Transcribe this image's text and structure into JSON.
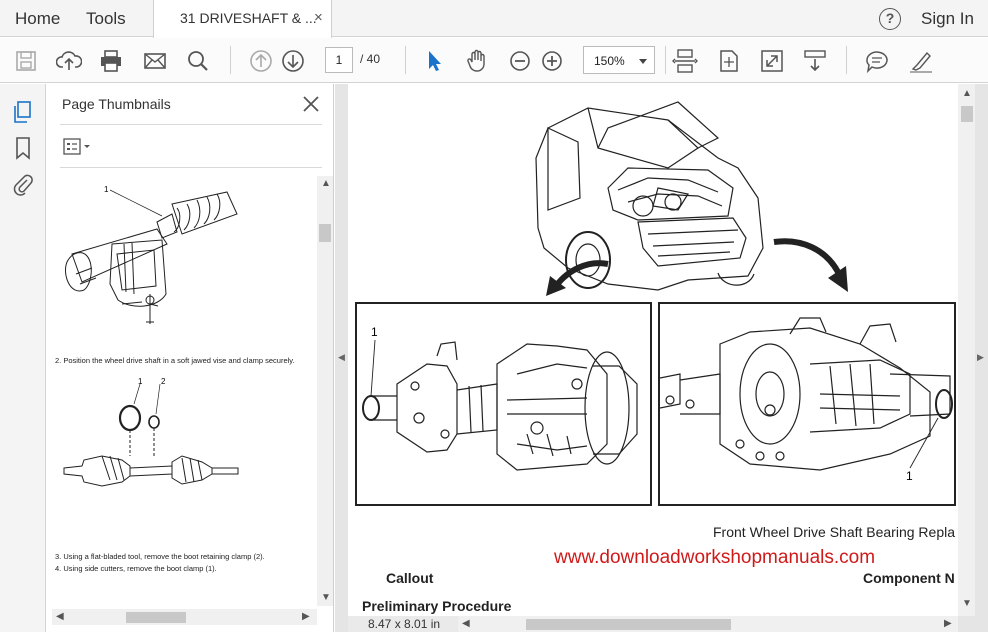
{
  "menubar": {
    "home_label": "Home",
    "tools_label": "Tools",
    "doc_tab_title": "31 DRIVESHAFT & ...",
    "doc_tab_close": "×",
    "help_label": "?",
    "signin_label": "Sign In"
  },
  "toolbar": {
    "current_page": "1",
    "total_pages": "/  40",
    "zoom_level": "150%",
    "icons": [
      "save-icon",
      "upload-icon",
      "print-icon",
      "email-icon",
      "search-icon",
      "page-up-icon",
      "page-down-icon",
      "select-cursor-icon",
      "hand-tool-icon",
      "zoom-out-icon",
      "zoom-in-icon",
      "scroll-mode-icon",
      "fit-page-icon",
      "fullscreen-icon",
      "read-mode-icon",
      "comment-icon",
      "highlight-icon"
    ],
    "accent_color": "#1a73c8"
  },
  "rail": {
    "icons": [
      "page-thumbnails-icon",
      "bookmark-icon",
      "attachment-icon"
    ]
  },
  "panel": {
    "title": "Page Thumbnails",
    "thumb_steps": {
      "step2": "2.     Position the wheel drive shaft in a soft jawed vise and clamp securely.",
      "step3": "3.     Using a flat-bladed tool, remove the boot retaining clamp (2).",
      "step4": "4.     Using side cutters, remove the boot clamp (1).",
      "label1a": "1",
      "label1b": "1",
      "label2": "2"
    }
  },
  "document": {
    "callout_left": "1",
    "callout_right": "1",
    "caption": "Front Wheel Drive Shaft Bearing Repla",
    "watermark": "www.downloadworkshopmanuals.com",
    "callout_heading": "Callout",
    "component_heading": "Component N",
    "prelim_heading": "Preliminary Procedure",
    "page_size": "8.47 x 8.01 in",
    "watermark_color": "#d01a1a"
  }
}
